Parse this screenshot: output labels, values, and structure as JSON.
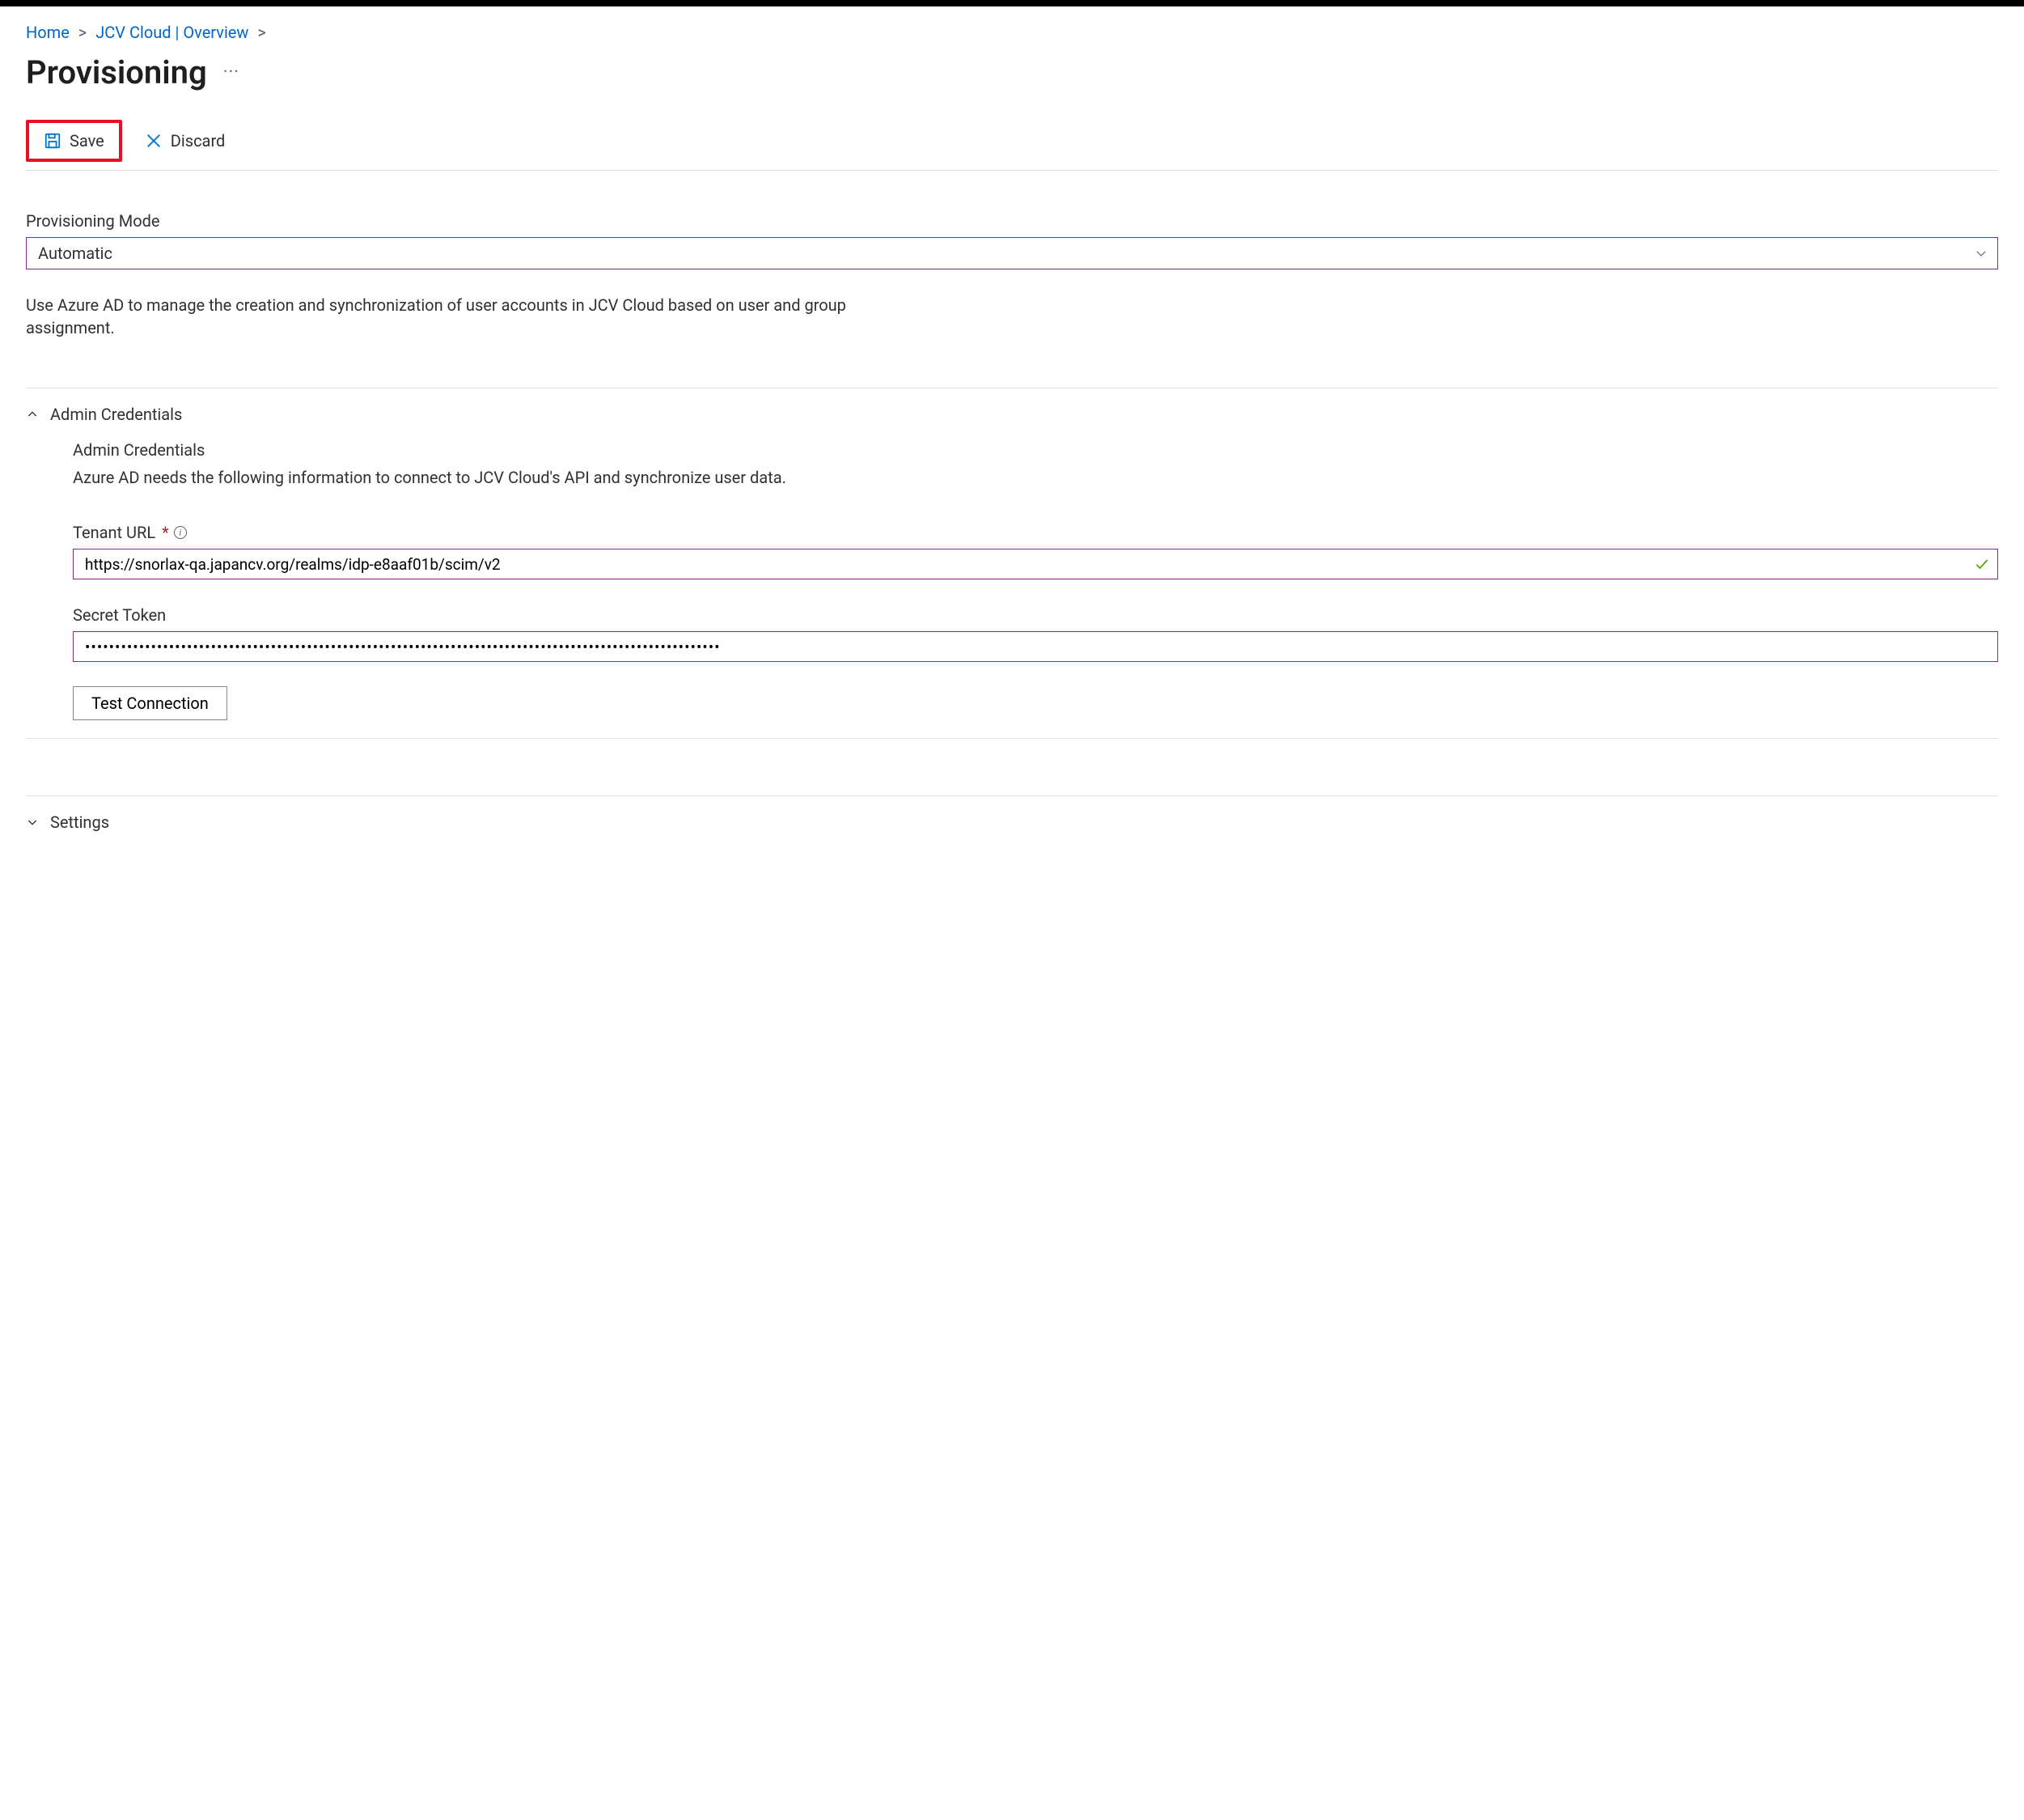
{
  "breadcrumbs": {
    "home": "Home",
    "app": "JCV Cloud | Overview"
  },
  "page_title": "Provisioning",
  "toolbar": {
    "save": "Save",
    "discard": "Discard"
  },
  "mode": {
    "label": "Provisioning Mode",
    "value": "Automatic"
  },
  "mode_description": "Use Azure AD to manage the creation and synchronization of user accounts in JCV Cloud based on user and group assignment.",
  "admin": {
    "header": "Admin Credentials",
    "sub_title": "Admin Credentials",
    "sub_desc": "Azure AD needs the following information to connect to JCV Cloud's API and synchronize user data.",
    "tenant_label": "Tenant URL",
    "tenant_value": "https://snorlax-qa.japancv.org/realms/idp-e8aaf01b/scim/v2",
    "secret_label": "Secret Token",
    "secret_value": "••••••••••••••••••••••••••••••••••••••••••••••••••••••••••••••••••••••••••••••••••••••••••••••••••••••••••",
    "test_connection": "Test Connection"
  },
  "settings": {
    "header": "Settings"
  }
}
